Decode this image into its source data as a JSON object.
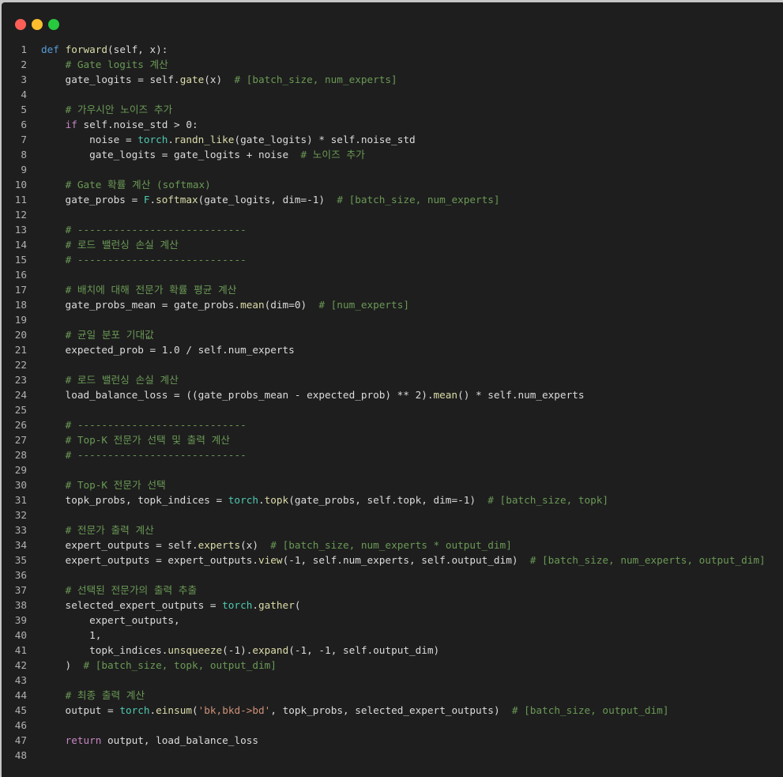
{
  "window": {
    "controls": [
      {
        "name": "close",
        "color": "#ff5f56"
      },
      {
        "name": "minimize",
        "color": "#ffbd2e"
      },
      {
        "name": "maximize",
        "color": "#27c93f"
      }
    ]
  },
  "colors": {
    "keyword": "#c586c0",
    "def": "#569cd6",
    "function": "#dcdcaa",
    "module": "#4ec9b0",
    "comment": "#6a9955",
    "string": "#ce9178",
    "text": "#dcdcdc"
  },
  "code_lines": [
    [
      [
        "kwdef",
        "def "
      ],
      [
        "fn",
        "forward"
      ],
      [
        "txt",
        "(self, x):"
      ]
    ],
    [
      [
        "txt",
        "    "
      ],
      [
        "cm",
        "# Gate logits 계산"
      ]
    ],
    [
      [
        "txt",
        "    gate_logits = self."
      ],
      [
        "fn",
        "gate"
      ],
      [
        "txt",
        "(x)  "
      ],
      [
        "cm",
        "# [batch_size, num_experts]"
      ]
    ],
    [],
    [
      [
        "txt",
        "    "
      ],
      [
        "cm",
        "# 가우시안 노이즈 추가"
      ]
    ],
    [
      [
        "txt",
        "    "
      ],
      [
        "kw",
        "if"
      ],
      [
        "txt",
        " self.noise_std > 0:"
      ]
    ],
    [
      [
        "txt",
        "        noise = "
      ],
      [
        "mod",
        "torch"
      ],
      [
        "txt",
        "."
      ],
      [
        "fn",
        "randn_like"
      ],
      [
        "txt",
        "(gate_logits) * self.noise_std"
      ]
    ],
    [
      [
        "txt",
        "        gate_logits = gate_logits + noise  "
      ],
      [
        "cm",
        "# 노이즈 추가"
      ]
    ],
    [],
    [
      [
        "txt",
        "    "
      ],
      [
        "cm",
        "# Gate 확률 계산 (softmax)"
      ]
    ],
    [
      [
        "txt",
        "    gate_probs = "
      ],
      [
        "mod",
        "F"
      ],
      [
        "txt",
        "."
      ],
      [
        "fn",
        "softmax"
      ],
      [
        "txt",
        "(gate_logits, dim=-1)  "
      ],
      [
        "cm",
        "# [batch_size, num_experts]"
      ]
    ],
    [],
    [
      [
        "txt",
        "    "
      ],
      [
        "cm",
        "# ----------------------------"
      ]
    ],
    [
      [
        "txt",
        "    "
      ],
      [
        "cm",
        "# 로드 밸런싱 손실 계산"
      ]
    ],
    [
      [
        "txt",
        "    "
      ],
      [
        "cm",
        "# ----------------------------"
      ]
    ],
    [],
    [
      [
        "txt",
        "    "
      ],
      [
        "cm",
        "# 배치에 대해 전문가 확률 평균 계산"
      ]
    ],
    [
      [
        "txt",
        "    gate_probs_mean = gate_probs."
      ],
      [
        "fn",
        "mean"
      ],
      [
        "txt",
        "(dim=0)  "
      ],
      [
        "cm",
        "# [num_experts]"
      ]
    ],
    [],
    [
      [
        "txt",
        "    "
      ],
      [
        "cm",
        "# 균일 분포 기대값"
      ]
    ],
    [
      [
        "txt",
        "    expected_prob = 1.0 / self.num_experts"
      ]
    ],
    [],
    [
      [
        "txt",
        "    "
      ],
      [
        "cm",
        "# 로드 밸런싱 손실 계산"
      ]
    ],
    [
      [
        "txt",
        "    load_balance_loss = ((gate_probs_mean - expected_prob) ** 2)."
      ],
      [
        "fn",
        "mean"
      ],
      [
        "txt",
        "() * self.num_experts"
      ]
    ],
    [],
    [
      [
        "txt",
        "    "
      ],
      [
        "cm",
        "# ----------------------------"
      ]
    ],
    [
      [
        "txt",
        "    "
      ],
      [
        "cm",
        "# Top-K 전문가 선택 및 출력 계산"
      ]
    ],
    [
      [
        "txt",
        "    "
      ],
      [
        "cm",
        "# ----------------------------"
      ]
    ],
    [],
    [
      [
        "txt",
        "    "
      ],
      [
        "cm",
        "# Top-K 전문가 선택"
      ]
    ],
    [
      [
        "txt",
        "    topk_probs, topk_indices = "
      ],
      [
        "mod",
        "torch"
      ],
      [
        "txt",
        "."
      ],
      [
        "fn",
        "topk"
      ],
      [
        "txt",
        "(gate_probs, self.topk, dim=-1)  "
      ],
      [
        "cm",
        "# [batch_size, topk]"
      ]
    ],
    [],
    [
      [
        "txt",
        "    "
      ],
      [
        "cm",
        "# 전문가 출력 계산"
      ]
    ],
    [
      [
        "txt",
        "    expert_outputs = self."
      ],
      [
        "fn",
        "experts"
      ],
      [
        "txt",
        "(x)  "
      ],
      [
        "cm",
        "# [batch_size, num_experts * output_dim]"
      ]
    ],
    [
      [
        "txt",
        "    expert_outputs = expert_outputs."
      ],
      [
        "fn",
        "view"
      ],
      [
        "txt",
        "(-1, self.num_experts, self.output_dim)  "
      ],
      [
        "cm",
        "# [batch_size, num_experts, output_dim]"
      ]
    ],
    [],
    [
      [
        "txt",
        "    "
      ],
      [
        "cm",
        "# 선택된 전문가의 출력 추출"
      ]
    ],
    [
      [
        "txt",
        "    selected_expert_outputs = "
      ],
      [
        "mod",
        "torch"
      ],
      [
        "txt",
        "."
      ],
      [
        "fn",
        "gather"
      ],
      [
        "txt",
        "("
      ]
    ],
    [
      [
        "txt",
        "        expert_outputs,"
      ]
    ],
    [
      [
        "txt",
        "        1,"
      ]
    ],
    [
      [
        "txt",
        "        topk_indices."
      ],
      [
        "fn",
        "unsqueeze"
      ],
      [
        "txt",
        "(-1)."
      ],
      [
        "fn",
        "expand"
      ],
      [
        "txt",
        "(-1, -1, self.output_dim)"
      ]
    ],
    [
      [
        "txt",
        "    )  "
      ],
      [
        "cm",
        "# [batch_size, topk, output_dim]"
      ]
    ],
    [],
    [
      [
        "txt",
        "    "
      ],
      [
        "cm",
        "# 최종 출력 계산"
      ]
    ],
    [
      [
        "txt",
        "    output = "
      ],
      [
        "mod",
        "torch"
      ],
      [
        "txt",
        "."
      ],
      [
        "fn",
        "einsum"
      ],
      [
        "txt",
        "("
      ],
      [
        "str",
        "'bk,bkd->bd'"
      ],
      [
        "txt",
        ", topk_probs, selected_expert_outputs)  "
      ],
      [
        "cm",
        "# [batch_size, output_dim]"
      ]
    ],
    [],
    [
      [
        "txt",
        "    "
      ],
      [
        "kw",
        "return"
      ],
      [
        "txt",
        " output, load_balance_loss"
      ]
    ],
    []
  ]
}
